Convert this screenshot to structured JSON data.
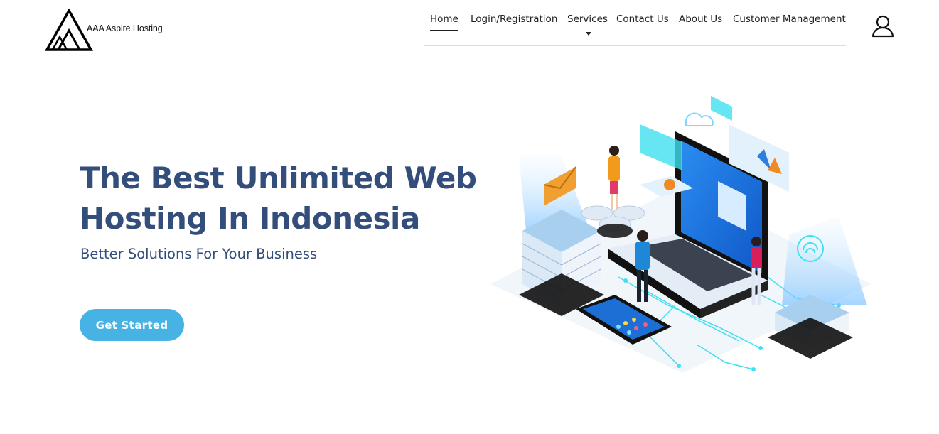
{
  "brand": {
    "name": "AAA Aspire Hosting"
  },
  "nav": {
    "items": [
      {
        "label": "Home",
        "active": true
      },
      {
        "label": "Login/Registration"
      },
      {
        "label": "Services",
        "has_dropdown": true
      },
      {
        "label": "Contact Us"
      },
      {
        "label": "About Us"
      },
      {
        "label": "Customer Management"
      }
    ]
  },
  "icons": {
    "account": "user-icon",
    "dropdown": "caret-down-icon"
  },
  "hero": {
    "title": "The Best Unlimited Web Hosting In Indonesia",
    "subtitle": "Better Solutions For Your Business",
    "cta_label": "Get Started"
  },
  "colors": {
    "heading": "#344e7c",
    "accent": "#47b2e4",
    "nav_text": "#222222"
  }
}
